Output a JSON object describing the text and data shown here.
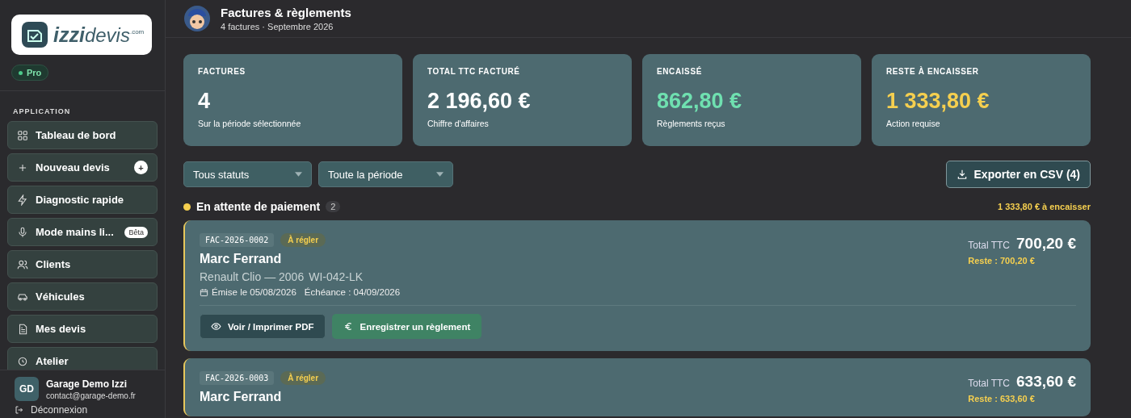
{
  "sidebar": {
    "logo": {
      "brand_bold": "izzi",
      "brand_light": "devis",
      "brand_suffix": ".com"
    },
    "plan_badge": "Pro",
    "section_label": "APPLICATION",
    "items": [
      {
        "label": "Tableau de bord",
        "selected": false
      },
      {
        "label": "Nouveau devis",
        "selected": false,
        "badge": "+",
        "kind": "circle"
      },
      {
        "label": "Diagnostic rapide",
        "selected": false
      },
      {
        "label": "Mode mains li...",
        "selected": false,
        "badge": "Bêta",
        "kind": "pill"
      },
      {
        "label": "Clients",
        "selected": false
      },
      {
        "label": "Véhicules",
        "selected": false
      },
      {
        "label": "Mes devis",
        "selected": false
      },
      {
        "label": "Atelier",
        "selected": false
      }
    ],
    "user": {
      "initials": "GD",
      "name": "Garage Demo Izzi",
      "email": "contact@garage-demo.fr"
    },
    "logout": "Déconnexion"
  },
  "header": {
    "title": "Factures & règlements",
    "subtitle": "4 factures · Septembre 2026"
  },
  "stats": [
    {
      "label": "FACTURES",
      "value": "4",
      "caption": "Sur la période sélectionnée",
      "color": "#ffffff"
    },
    {
      "label": "TOTAL TTC FACTURÉ",
      "value": "2 196,60 €",
      "caption": "Chiffre d'affaires",
      "color": "#ffffff"
    },
    {
      "label": "ENCAISSÉ",
      "value": "862,80 €",
      "caption": "Règlements reçus",
      "color": "#6fe0b0"
    },
    {
      "label": "RESTE À ENCAISSER",
      "value": "1 333,80 €",
      "caption": "Action requise",
      "color": "#f5cf4f"
    }
  ],
  "filters": [
    {
      "value": "Tous statuts"
    },
    {
      "value": "Toute la période"
    }
  ],
  "export_button": "Exporter en CSV (4)",
  "group": {
    "title": "En attente de paiement",
    "count": "2",
    "color": "#f5cf4f",
    "total": "1 333,80 € à encaisser"
  },
  "invoices": [
    {
      "number": "FAC-2026-0002",
      "status": "À régler",
      "client": "Marc Ferrand",
      "vehicle": "Renault Clio — 2006",
      "plate": "WI-042-LK",
      "issued": "Émise le 05/08/2026",
      "due": "Échéance : 04/09/2026",
      "total_label": "Total TTC",
      "total": "700,20 €",
      "remaining": "Reste : 700,20 €",
      "actions": [
        {
          "label": "Voir / Imprimer PDF",
          "kind": "view"
        },
        {
          "label": "Enregistrer un règlement",
          "kind": "pay"
        }
      ]
    },
    {
      "number": "FAC-2026-0003",
      "status": "À régler",
      "client": "Marc Ferrand",
      "total_label": "Total TTC",
      "total": "633,60 €",
      "remaining": "Reste : 633,60 €"
    }
  ]
}
